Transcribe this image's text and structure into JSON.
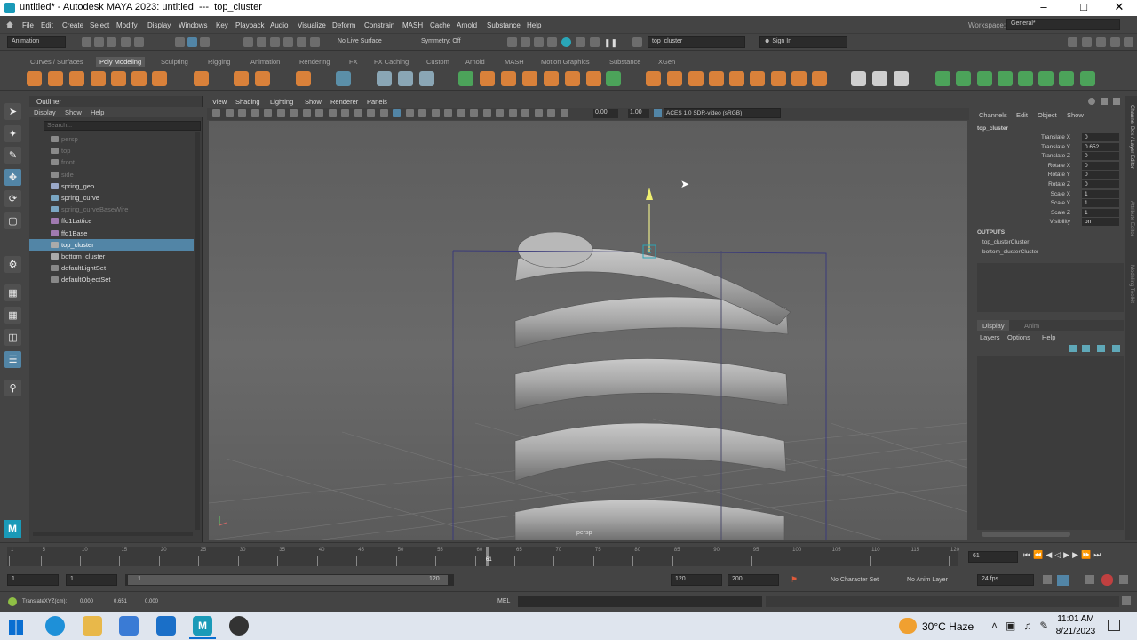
{
  "window": {
    "title": "untitled* - Autodesk MAYA 2023: untitled",
    "separator": "---",
    "object": "top_cluster"
  },
  "menus": [
    "File",
    "Edit",
    "Create",
    "Select",
    "Modify",
    "Display",
    "Windows",
    "Key",
    "Playback",
    "Audio",
    "Visualize",
    "Deform",
    "Constrain",
    "MASH",
    "Cache",
    "Arnold",
    "Substance",
    "Help"
  ],
  "workspace": {
    "label": "Workspace:",
    "value": "General*"
  },
  "statusline": {
    "menuset": "Animation",
    "live_surface": "No Live Surface",
    "symmetry": "Symmetry: Off",
    "object_name": "top_cluster",
    "signin": "Sign In"
  },
  "shelf_tabs": [
    "Curves / Surfaces",
    "Poly Modeling",
    "Sculpting",
    "Rigging",
    "Animation",
    "Rendering",
    "FX",
    "FX Caching",
    "Custom",
    "Arnold",
    "MASH",
    "Motion Graphics",
    "Substance",
    "XGen"
  ],
  "shelf_active": "Poly Modeling",
  "outliner": {
    "title": "Outliner",
    "menu": [
      "Display",
      "Show",
      "Help"
    ],
    "search_placeholder": "Search...",
    "items": [
      {
        "label": "persp",
        "dim": true,
        "icon": "camera-icon"
      },
      {
        "label": "top",
        "dim": true,
        "icon": "camera-icon"
      },
      {
        "label": "front",
        "dim": true,
        "icon": "camera-icon"
      },
      {
        "label": "side",
        "dim": true,
        "icon": "camera-icon"
      },
      {
        "label": "spring_geo",
        "dim": false,
        "icon": "mesh-icon"
      },
      {
        "label": "spring_curve",
        "dim": false,
        "icon": "curve-icon"
      },
      {
        "label": "spring_curveBaseWire",
        "dim": true,
        "icon": "curve-icon"
      },
      {
        "label": "ffd1Lattice",
        "dim": false,
        "icon": "lattice-icon"
      },
      {
        "label": "ffd1Base",
        "dim": false,
        "icon": "lattice-icon"
      },
      {
        "label": "top_cluster",
        "dim": false,
        "selected": true,
        "icon": "cluster-icon"
      },
      {
        "label": "bottom_cluster",
        "dim": false,
        "icon": "cluster-icon"
      },
      {
        "label": "defaultLightSet",
        "dim": false,
        "icon": "set-icon"
      },
      {
        "label": "defaultObjectSet",
        "dim": false,
        "icon": "set-icon"
      }
    ]
  },
  "viewport": {
    "menu": [
      "View",
      "Shading",
      "Lighting",
      "Show",
      "Renderer",
      "Panels"
    ],
    "field1": "0.00",
    "field2": "1.00",
    "colorspace": "ACES 1.0 SDR-video (sRGB)",
    "camera": "persp",
    "handle_label": "C"
  },
  "channelbox": {
    "menu": [
      "Channels",
      "Edit",
      "Object",
      "Show"
    ],
    "node": "top_cluster",
    "attrs": [
      {
        "name": "Translate X",
        "value": "0"
      },
      {
        "name": "Translate Y",
        "value": "0.652"
      },
      {
        "name": "Translate Z",
        "value": "0"
      },
      {
        "name": "Rotate X",
        "value": "0"
      },
      {
        "name": "Rotate Y",
        "value": "0"
      },
      {
        "name": "Rotate Z",
        "value": "0"
      },
      {
        "name": "Scale X",
        "value": "1"
      },
      {
        "name": "Scale Y",
        "value": "1"
      },
      {
        "name": "Scale Z",
        "value": "1"
      },
      {
        "name": "Visibility",
        "value": "on"
      }
    ],
    "outputs_title": "OUTPUTS",
    "outputs": [
      "top_clusterCluster",
      "bottom_clusterCluster"
    ],
    "side_tabs": [
      "Channel Box / Layer Editor",
      "Attribute Editor",
      "Modeling Toolkit"
    ]
  },
  "layers": {
    "tabs": [
      "Display",
      "Anim"
    ],
    "menu": [
      "Layers",
      "Options",
      "Help"
    ]
  },
  "timeline": {
    "ticks": [
      "1",
      "5",
      "10",
      "15",
      "20",
      "25",
      "30",
      "35",
      "40",
      "45",
      "50",
      "55",
      "60",
      "65",
      "70",
      "75",
      "80",
      "85",
      "90",
      "95",
      "100",
      "105",
      "110",
      "115",
      "120"
    ],
    "current": "61",
    "current_field": "61"
  },
  "range": {
    "start": "1",
    "playstart": "1",
    "slider_start": "1",
    "slider_end": "120",
    "end": "120",
    "max": "200",
    "char_set": "No Character Set",
    "anim_layer": "No Anim Layer",
    "fps": "24 fps"
  },
  "cmdline": {
    "help": "TranslateXYZ(cm):",
    "x": "0.000",
    "y": "0.651",
    "z": "0.000",
    "lang": "MEL"
  },
  "taskbar": {
    "weather": "30°C  Haze",
    "time": "11:01 AM",
    "date": "8/21/2023"
  }
}
